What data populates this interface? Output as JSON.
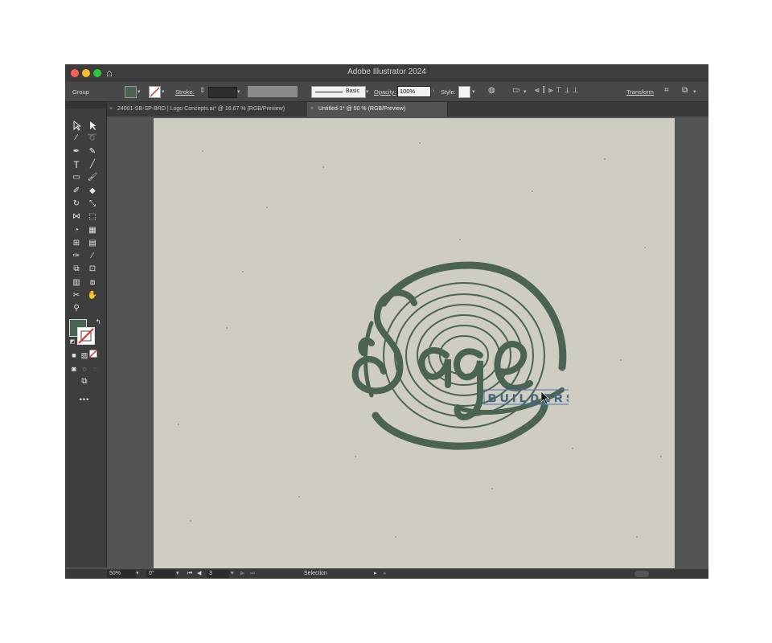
{
  "app": {
    "title": "Adobe Illustrator 2024"
  },
  "control_bar": {
    "selection_type": "Group",
    "fill_color": "#4b6353",
    "stroke_label": "Stroke:",
    "brush_style": "Basic",
    "opacity_label": "Opacity:",
    "opacity_value": "100%",
    "style_label": "Style:",
    "transform_label": "Transform"
  },
  "tabs": [
    {
      "label": "24001-SB-SP-BRD | Logo Concepts.ai* @ 16.67 % (RGB/Preview)",
      "active": false
    },
    {
      "label": "Untitled-1* @ 50 % (RGB/Preview)",
      "active": true
    }
  ],
  "toolbar": {
    "fill_color": "#4b6353",
    "more_label": "•••"
  },
  "artwork": {
    "background_color": "#cfcdc2",
    "ink_color": "#4b6353",
    "script_text": "Sage",
    "subtitle_text": "BUILDERS",
    "selection_color": "#4a6fb5"
  },
  "status_bar": {
    "zoom": "50%",
    "rotation": "0°",
    "artboard_number": "3",
    "tool_name": "Selection"
  }
}
